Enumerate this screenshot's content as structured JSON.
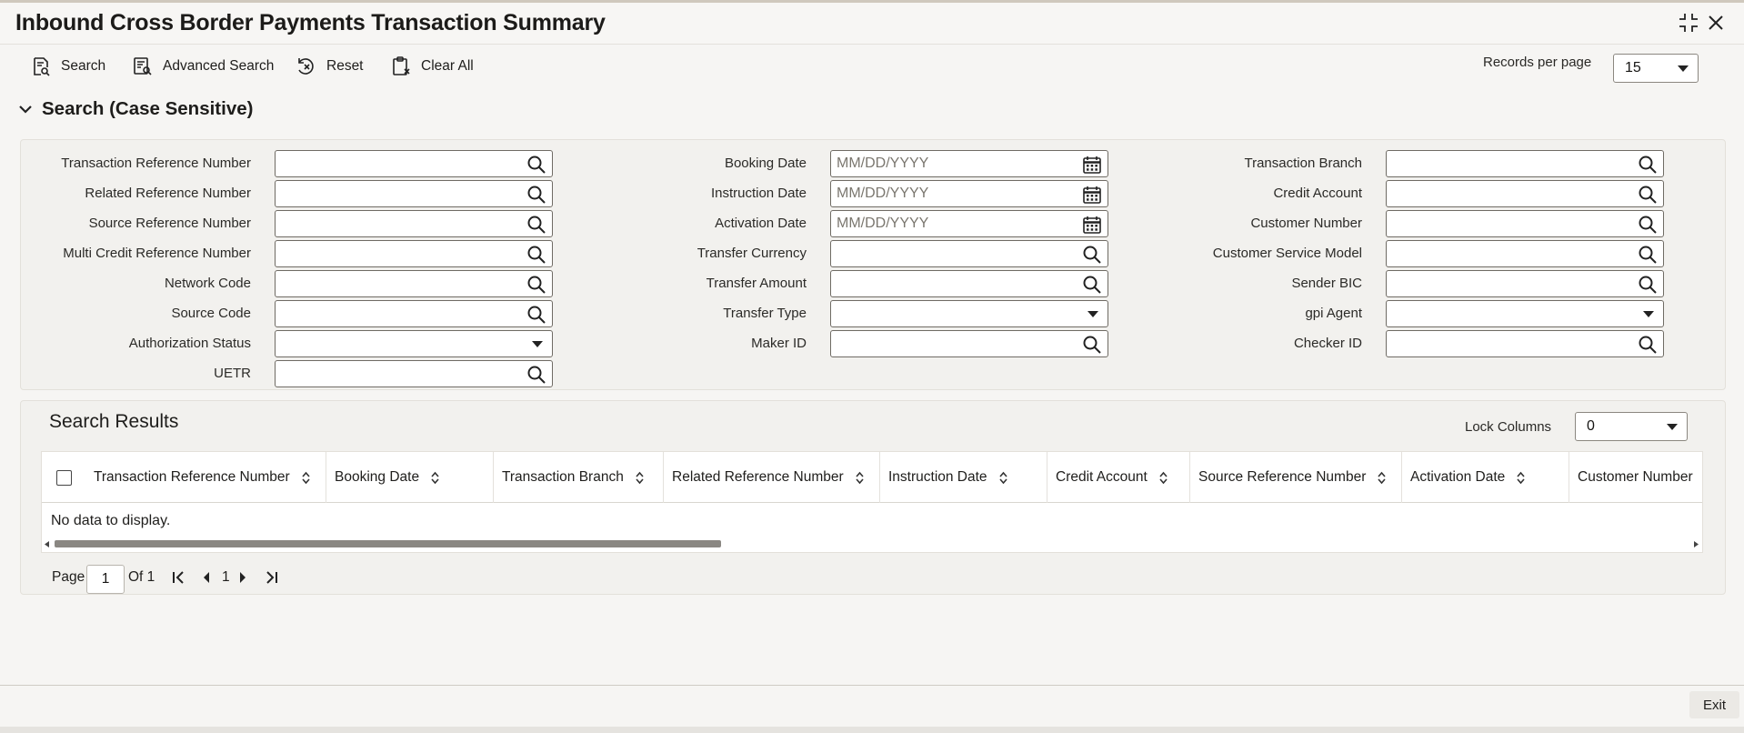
{
  "window": {
    "title": "Inbound Cross Border Payments Transaction Summary"
  },
  "toolbar": {
    "search_label": "Search",
    "advanced_search_label": "Advanced Search",
    "reset_label": "Reset",
    "clear_all_label": "Clear All",
    "records_per_page_label": "Records per page",
    "records_per_page_value": "15"
  },
  "search_section": {
    "title": "Search (Case Sensitive)"
  },
  "fields": {
    "col1": [
      {
        "label": "Transaction Reference Number",
        "value": "",
        "kind": "lookup"
      },
      {
        "label": "Related Reference Number",
        "value": "",
        "kind": "lookup"
      },
      {
        "label": "Source Reference Number",
        "value": "",
        "kind": "lookup"
      },
      {
        "label": "Multi Credit Reference Number",
        "value": "",
        "kind": "lookup"
      },
      {
        "label": "Network Code",
        "value": "",
        "kind": "lookup"
      },
      {
        "label": "Source Code",
        "value": "",
        "kind": "lookup"
      },
      {
        "label": "Authorization Status",
        "value": "",
        "kind": "select"
      },
      {
        "label": "UETR",
        "value": "",
        "kind": "lookup"
      }
    ],
    "col2": [
      {
        "label": "Booking Date",
        "value": "MM/DD/YYYY",
        "kind": "date"
      },
      {
        "label": "Instruction Date",
        "value": "MM/DD/YYYY",
        "kind": "date"
      },
      {
        "label": "Activation Date",
        "value": "MM/DD/YYYY",
        "kind": "date"
      },
      {
        "label": "Transfer Currency",
        "value": "",
        "kind": "lookup"
      },
      {
        "label": "Transfer Amount",
        "value": "",
        "kind": "lookup"
      },
      {
        "label": "Transfer Type",
        "value": "",
        "kind": "select"
      },
      {
        "label": "Maker ID",
        "value": "",
        "kind": "lookup"
      }
    ],
    "col3": [
      {
        "label": "Transaction Branch",
        "value": "",
        "kind": "lookup"
      },
      {
        "label": "Credit Account",
        "value": "",
        "kind": "lookup"
      },
      {
        "label": "Customer Number",
        "value": "",
        "kind": "lookup"
      },
      {
        "label": "Customer Service Model",
        "value": "",
        "kind": "lookup"
      },
      {
        "label": "Sender BIC",
        "value": "",
        "kind": "lookup"
      },
      {
        "label": "gpi Agent",
        "value": "",
        "kind": "select"
      },
      {
        "label": "Checker ID",
        "value": "",
        "kind": "lookup"
      }
    ]
  },
  "results": {
    "title": "Search Results",
    "lock_columns_label": "Lock Columns",
    "lock_columns_value": "0",
    "columns": [
      "Transaction Reference Number",
      "Booking Date",
      "Transaction Branch",
      "Related Reference Number",
      "Instruction Date",
      "Credit Account",
      "Source Reference Number",
      "Activation Date",
      "Customer Number"
    ],
    "empty_text": "No data to display."
  },
  "pagination": {
    "page_label": "Page",
    "current_page": "1",
    "of_label": "Of 1",
    "page_number": "1"
  },
  "footer": {
    "exit_label": "Exit"
  }
}
